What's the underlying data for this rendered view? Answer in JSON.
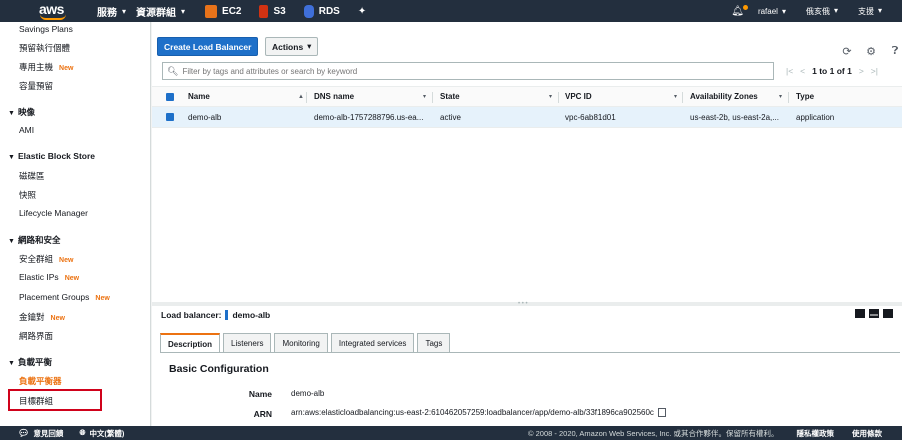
{
  "topnav": {
    "logo_text": "aws",
    "services_label": "服務",
    "resource_groups_label": "資源群組",
    "shortcuts": [
      {
        "icon": "ec2-icon",
        "label": "EC2"
      },
      {
        "icon": "s3-icon",
        "label": "S3"
      },
      {
        "icon": "rds-icon",
        "label": "RDS"
      }
    ],
    "pin_icon": "pin-icon",
    "user": "rafael",
    "region": "俄亥俄",
    "support": "支援",
    "chevron": "▾"
  },
  "sidebar": {
    "items": [
      {
        "label": "Savings Plans"
      },
      {
        "label": "預留執行個體"
      },
      {
        "label": "專用主機",
        "badge": "New"
      },
      {
        "label": "容量預留"
      },
      {
        "section": "映像"
      },
      {
        "label": "AMI"
      },
      {
        "section": "Elastic Block Store"
      },
      {
        "label": "磁碟區"
      },
      {
        "label": "快照"
      },
      {
        "label": "Lifecycle Manager"
      },
      {
        "section": "網路和安全"
      },
      {
        "label": "安全群組",
        "badge": "New"
      },
      {
        "label": "Elastic IPs",
        "badge": "New"
      },
      {
        "label": "Placement Groups",
        "badge": "New"
      },
      {
        "label": "金鑰對",
        "badge": "New"
      },
      {
        "label": "網路界面"
      },
      {
        "section": "負載平衡"
      },
      {
        "label": "負載平衡器",
        "active": true
      },
      {
        "label": "目標群組"
      }
    ]
  },
  "toolbar": {
    "create_label": "Create Load Balancer",
    "actions_label": "Actions",
    "refresh_icon": "refresh-icon",
    "settings_icon": "gear-icon",
    "help_icon": "help-icon"
  },
  "filter": {
    "placeholder": "Filter by tags and attributes or search by keyword",
    "range": "1 to 1 of 1"
  },
  "table": {
    "headers": [
      "Name",
      "DNS name",
      "State",
      "VPC ID",
      "Availability Zones",
      "Type"
    ],
    "rows": [
      [
        "demo-alb",
        "demo-alb-1757288796.us-ea...",
        "active",
        "vpc-6ab81d01",
        "us-east-2b, us-east-2a,...",
        "application"
      ]
    ]
  },
  "details": {
    "lb_label": "Load balancer:",
    "lb_name": "demo-alb",
    "tabs": [
      "Description",
      "Listeners",
      "Monitoring",
      "Integrated services",
      "Tags"
    ],
    "section_title": "Basic Configuration",
    "fields": [
      {
        "label": "Name",
        "value": "demo-alb"
      },
      {
        "label": "ARN",
        "value": "arn:aws:elasticloadbalancing:us-east-2:610462057259:loadbalancer/app/demo-alb/33f1896ca902560c"
      }
    ]
  },
  "footer": {
    "feedback": "意見回饋",
    "language": "中文(繁體)",
    "copyright": "© 2008 - 2020, Amazon Web Services, Inc. 或其合作夥伴。保留所有權利。",
    "privacy": "隱私權政策",
    "terms": "使用條款"
  },
  "colors": {
    "nav_bg": "#232f3e",
    "primary": "#1e70c9",
    "accent": "#ec7211",
    "highlight_box": "#d0021b"
  }
}
